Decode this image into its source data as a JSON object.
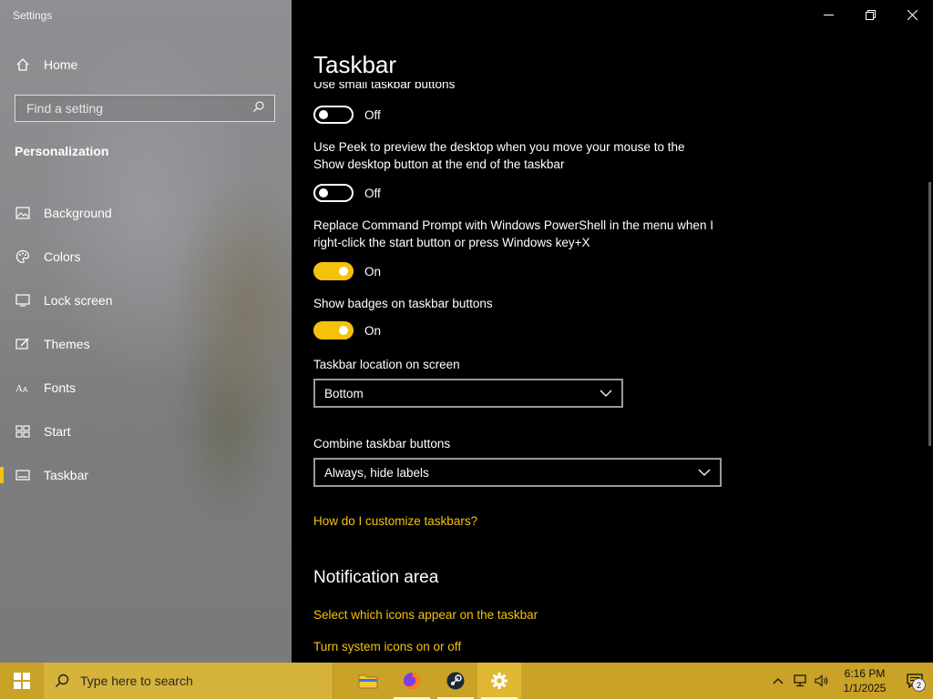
{
  "window": {
    "title": "Settings"
  },
  "sidebar": {
    "home_label": "Home",
    "search_placeholder": "Find a setting",
    "section_title": "Personalization",
    "items": [
      {
        "label": "Background",
        "icon": "image-icon"
      },
      {
        "label": "Colors",
        "icon": "palette-icon"
      },
      {
        "label": "Lock screen",
        "icon": "monitor-lock-icon"
      },
      {
        "label": "Themes",
        "icon": "brush-icon"
      },
      {
        "label": "Fonts",
        "icon": "font-icon"
      },
      {
        "label": "Start",
        "icon": "start-grid-icon"
      },
      {
        "label": "Taskbar",
        "icon": "taskbar-icon",
        "active": true
      }
    ]
  },
  "main": {
    "title": "Taskbar",
    "settings": {
      "small_buttons": {
        "label": "Use small taskbar buttons",
        "state": "Off"
      },
      "peek": {
        "label": "Use Peek to preview the desktop when you move your mouse to the Show desktop button at the end of the taskbar",
        "state": "Off"
      },
      "powershell": {
        "label": "Replace Command Prompt with Windows PowerShell in the menu when I right-click the start button or press Windows key+X",
        "state": "On"
      },
      "badges": {
        "label": "Show badges on taskbar buttons",
        "state": "On"
      },
      "location": {
        "label": "Taskbar location on screen",
        "value": "Bottom"
      },
      "combine": {
        "label": "Combine taskbar buttons",
        "value": "Always, hide labels"
      }
    },
    "help_link": "How do I customize taskbars?",
    "notification_area": {
      "heading": "Notification area",
      "link1": "Select which icons appear on the taskbar",
      "link2": "Turn system icons on or off"
    }
  },
  "taskbar": {
    "search_placeholder": "Type here to search",
    "apps": [
      "file-explorer-icon",
      "firefox-icon",
      "steam-icon",
      "settings-gear-icon"
    ],
    "clock": {
      "time": "6:16 PM",
      "date": "1/1/2025"
    },
    "notification_count": "2"
  },
  "colors": {
    "accent": "#f4c20d",
    "taskbar": "#c9a227",
    "main_bg": "#000000"
  }
}
